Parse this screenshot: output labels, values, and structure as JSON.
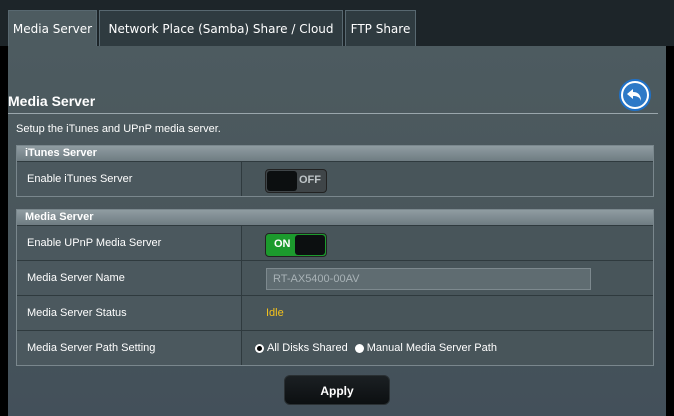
{
  "tabs": [
    {
      "label": "Media Server",
      "active": true
    },
    {
      "label": "Network Place (Samba) Share / Cloud Disk",
      "active": false
    },
    {
      "label": "FTP Share",
      "active": false
    }
  ],
  "page": {
    "title": "Media Server",
    "description": "Setup the iTunes and UPnP media server.",
    "back_icon": "back-arrow-icon"
  },
  "itunes_section": {
    "header": "iTunes Server",
    "enable_label": "Enable iTunes Server",
    "toggle_text": "OFF",
    "enabled": false
  },
  "media_section": {
    "header": "Media Server",
    "enable_label": "Enable UPnP Media Server",
    "toggle_text": "ON",
    "enabled": true,
    "name_label": "Media Server Name",
    "name_value": "RT-AX5400-00AV",
    "status_label": "Media Server Status",
    "status_value": "Idle",
    "path_label": "Media Server Path Setting",
    "path_options": [
      "All Disks Shared",
      "Manual Media Server Path"
    ],
    "path_selected": "All Disks Shared"
  },
  "actions": {
    "apply_label": "Apply"
  },
  "colors": {
    "status": "#f5c21b",
    "toggle_on": "#1c9a2d",
    "accent": "#2d79c7"
  }
}
